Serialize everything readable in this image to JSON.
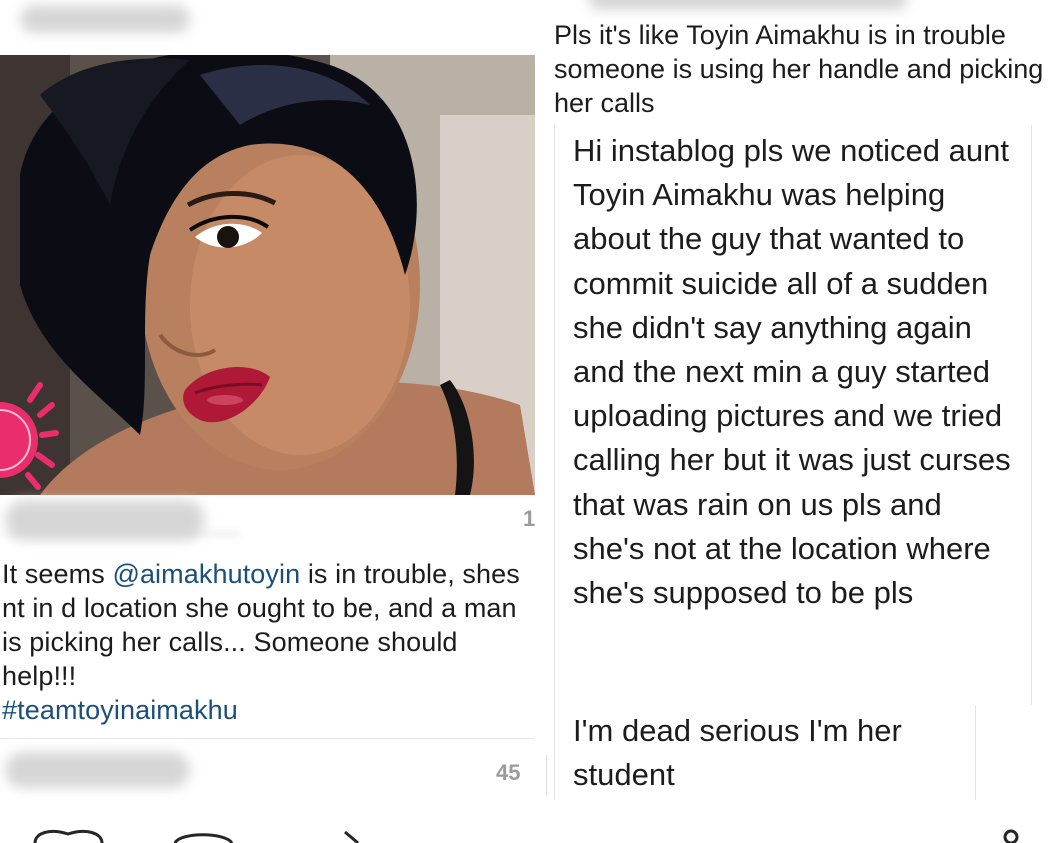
{
  "left_post": {
    "likes_count": "1",
    "caption_prefix": "It seems ",
    "mention": "@aimakhutoyin",
    "caption_body": " is in trouble, shes nt in d location she ought to be, and a man is picking her calls... Someone should help!!!",
    "hashtag": "#teamtoyinaimakhu",
    "comment_count": "45"
  },
  "right_post": {
    "top_note": "Pls it's like Toyin Aimakhu is in trouble someone is using her handle and picking her calls",
    "message_1": "Hi instablog pls we noticed aunt Toyin Aimakhu was helping about the guy that wanted to commit suicide all of a sudden she didn't say anything again and the next min a guy started uploading pictures and we tried calling her but it was just curses that was rain on us pls and she's not at the location where she's supposed to be pls",
    "message_2": "I'm dead serious I'm her student"
  },
  "colors": {
    "link_blue": "#1b4f7a",
    "text_dark": "#1c1c1c",
    "muted_gray": "#9b9b9b"
  },
  "icons": [
    "heart-icon",
    "comment-icon",
    "share-icon",
    "bookmark-icon"
  ]
}
